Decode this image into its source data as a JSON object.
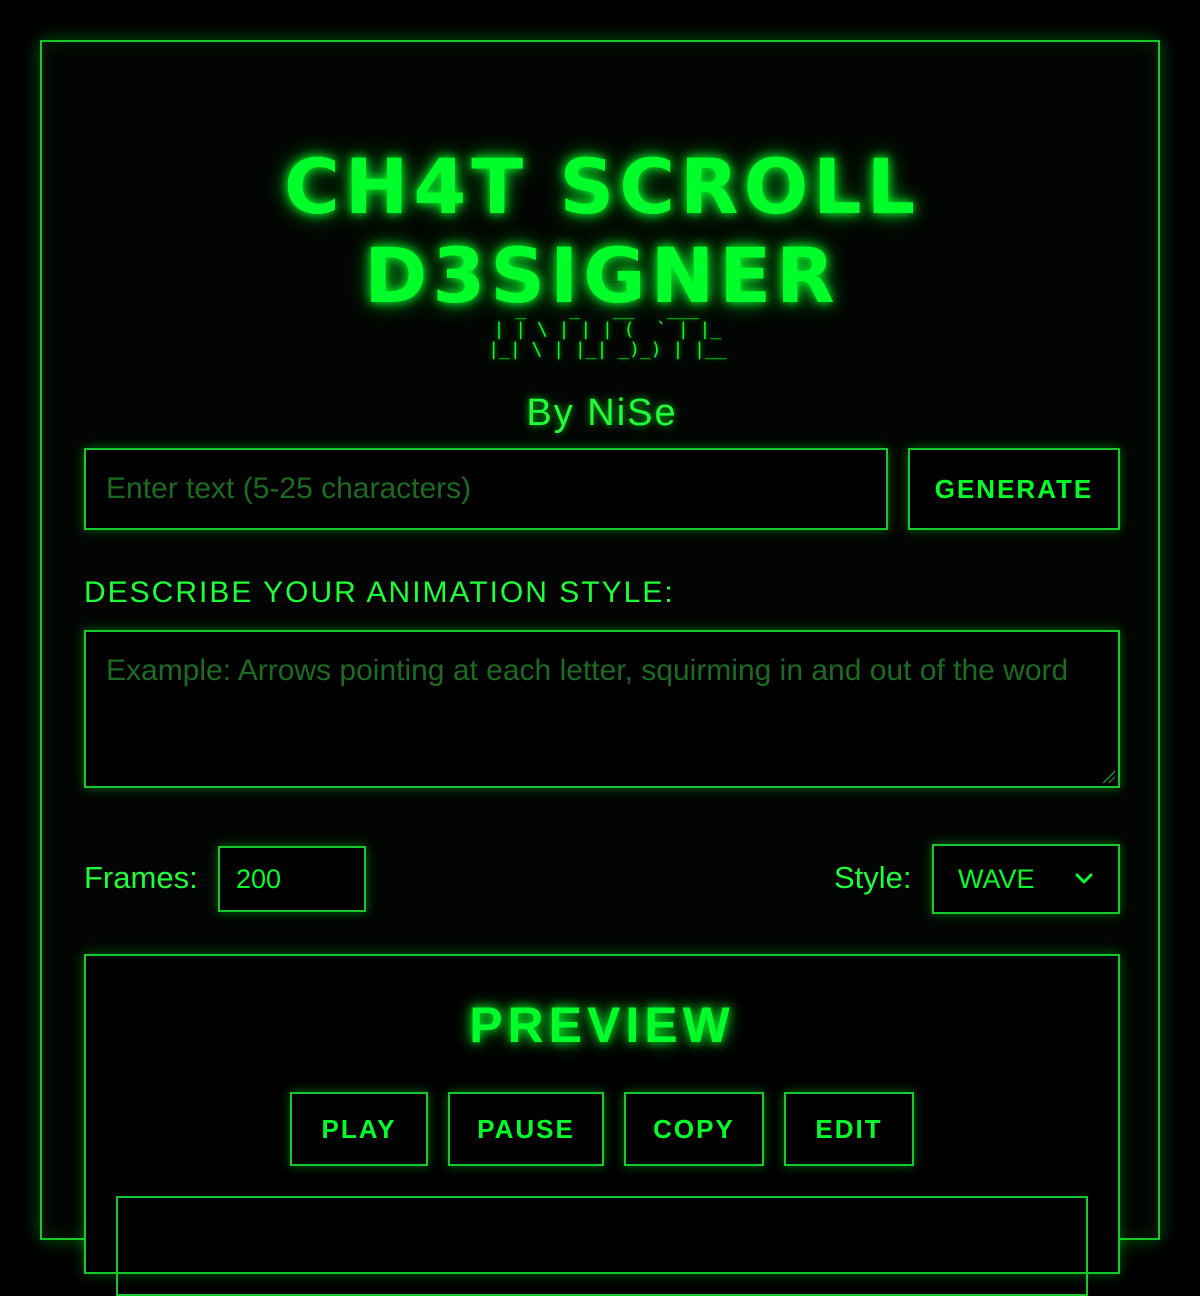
{
  "header": {
    "title": "CH4T SCROLL D3SIGNER",
    "ascii_art": " _    _   __   ___\n | | \\ | | | (  ` | |_\n |_| \\ | |_| _)_) | |__",
    "byline": "By NiSe"
  },
  "text_input": {
    "placeholder": "Enter text (5-25 characters)",
    "value": ""
  },
  "generate_button": {
    "label": "GENERATE"
  },
  "description": {
    "label": "DESCRIBE YOUR ANIMATION STYLE:",
    "placeholder": "Example: Arrows pointing at each letter, squirming in and out of the word"
  },
  "frames": {
    "label": "Frames:",
    "value": "200"
  },
  "style": {
    "label": "Style:",
    "selected": "WAVE"
  },
  "preview": {
    "title": "PREVIEW",
    "buttons": {
      "play": "PLAY",
      "pause": "PAUSE",
      "copy": "COPY",
      "edit": "EDIT"
    }
  },
  "colors": {
    "accent": "#00ff2a",
    "border": "#16c82e",
    "placeholder": "#1b6b23",
    "background": "#000000"
  },
  "icons": {
    "select_arrow": "chevron-down-icon",
    "resize": "resize-handle-icon"
  }
}
